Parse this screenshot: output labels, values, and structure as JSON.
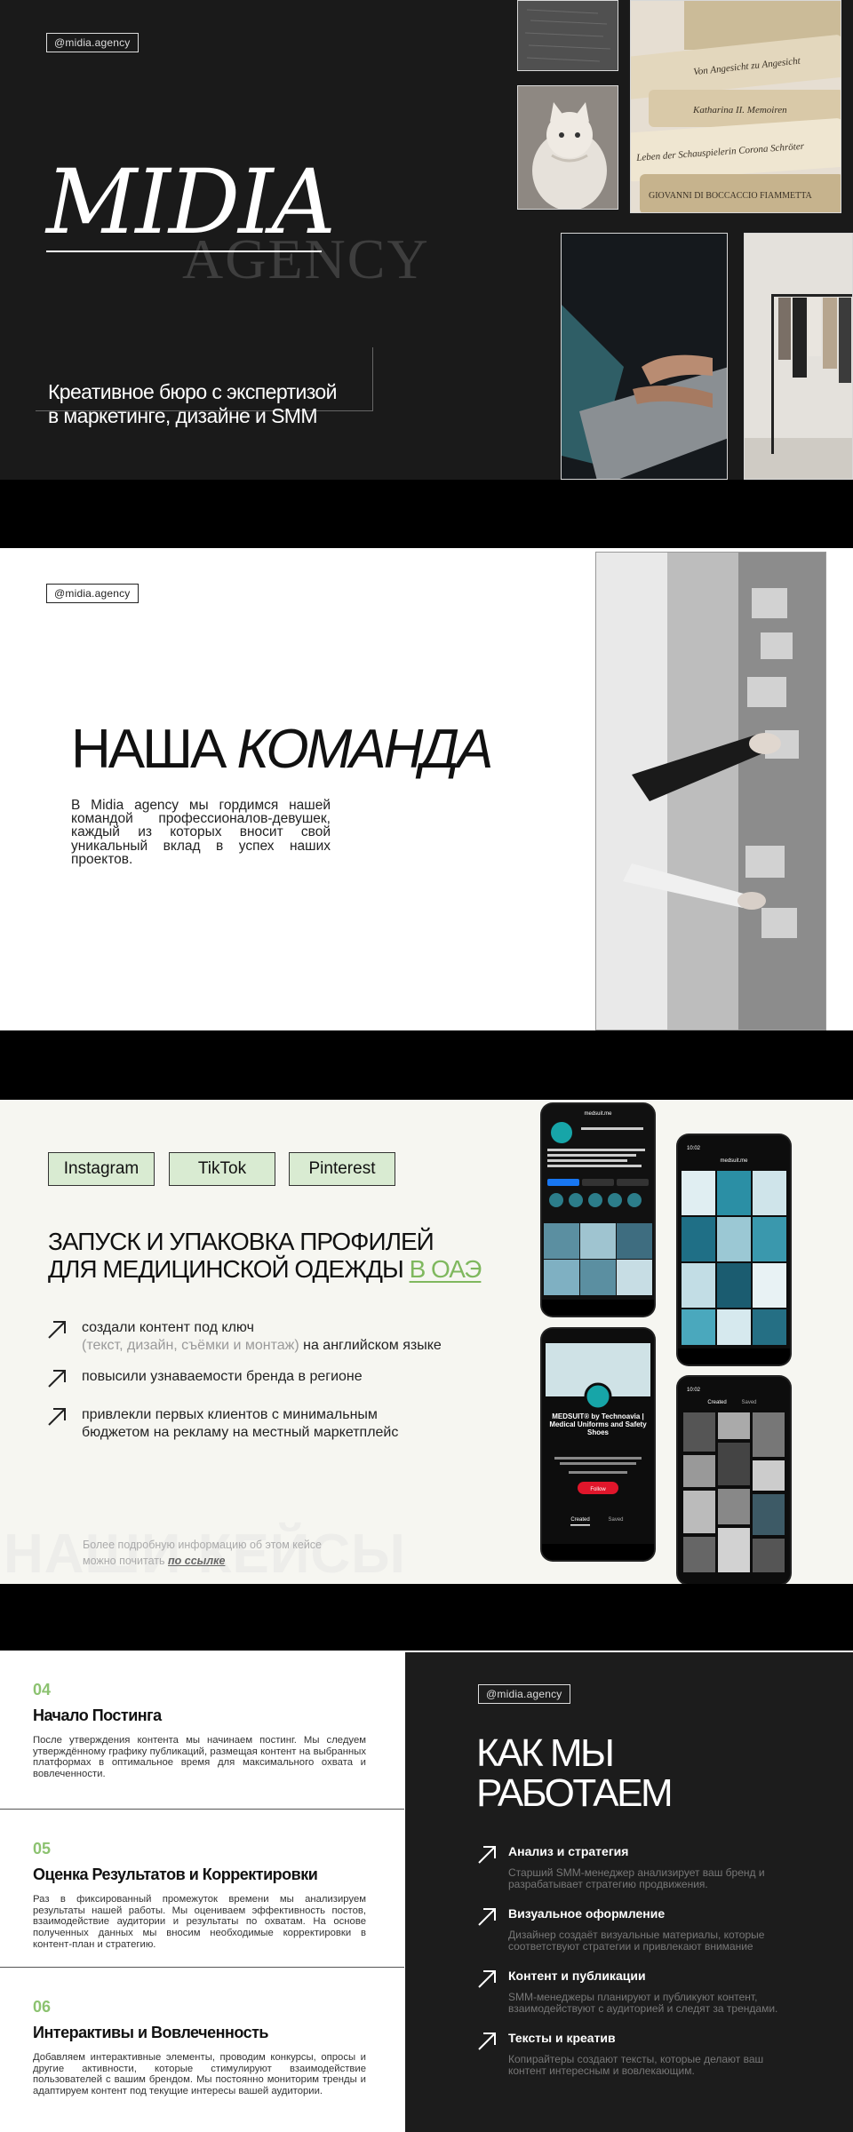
{
  "handle": "@midia.agency",
  "slide1": {
    "brand": "MIDIA",
    "brand_sub": "AGENCY",
    "tagline_l1": "Креативное бюро с экспертизой",
    "tagline_l2": "в маркетинге, дизайне и SMM",
    "book_texts": [
      "Von Angesicht zu Angesicht",
      "Katharina II. Memoiren",
      "Leben der Schauspielerin Corona Schröter",
      "GIOVANNI DI BOCCACCIO FIAMMETTA"
    ]
  },
  "slide2": {
    "title_a": "НАША",
    "title_b": "КОМАНДА",
    "description": "В Midia agency мы гордимся нашей командой профессионалов-девушек, каждый из которых вносит свой уникальный вклад в успех наших проектов."
  },
  "slide3": {
    "tabs": [
      "Instagram",
      "TikTok",
      "Pinterest"
    ],
    "title_l1": "ЗАПУСК И УПАКОВКА ПРОФИЛЕЙ",
    "title_l2": "ДЛЯ МЕДИЦИНСКОЙ ОДЕЖДЫ",
    "title_hl": "В ОАЭ",
    "b1_a": "создали контент под ключ",
    "b1_grey": "(текст, дизайн, съёмки и монтаж)",
    "b1_b": "на английском языке",
    "b2": "повысили узнаваемости бренда в регионе",
    "b3_l1": "привлекли первых клиентов с минимальным",
    "b3_l2": "бюджетом на рекламу на местный маркетплейс",
    "more_l1": "Более подробную информацию об этом кейсе",
    "more_l2": "можно почитать",
    "more_link": "по ссылке",
    "ghost": "НАШИ КЕЙСЫ",
    "phone_account": "medsuit.me",
    "phone_profile_title": "MEDSUIT® by Technoavia | Medical Uniforms and Safety Shoes",
    "phone_follow": "Follow",
    "phone_created": "Created",
    "phone_saved": "Saved",
    "phone_time": "10:02"
  },
  "slide4": {
    "steps": [
      {
        "num": "04",
        "title": "Начало Постинга",
        "text": "После утверждения контента мы начинаем постинг. Мы следуем утверждённому графику публикаций, размещая контент на выбранных платформах в оптимальное время для максимального охвата и вовлеченности."
      },
      {
        "num": "05",
        "title": "Оценка Результатов и Корректировки",
        "text": "Раз в фиксированный промежуток времени мы анализируем результаты нашей работы. Мы оцениваем эффективность постов, взаимодействие аудитории и результаты по охватам. На основе полученных данных мы вносим необходимые корректировки в контент-план и стратегию."
      },
      {
        "num": "06",
        "title": "Интерактивы и Вовлеченность",
        "text": "Добавляем интерактивные элементы, проводим конкурсы, опросы и другие активности, которые стимулируют взаимодействие пользователей с вашим брендом. Мы постоянно мониторим тренды и адаптируем контент под текущие интересы вашей аудитории."
      }
    ],
    "how_l1": "КАК МЫ",
    "how_l2": "РАБОТАЕМ",
    "items": [
      {
        "title": "Анализ и стратегия",
        "text": "Старший SMM-менеджер анализирует ваш бренд и разрабатывает стратегию продвижения."
      },
      {
        "title": "Визуальное оформление",
        "text": "Дизайнер создаёт визуальные материалы, которые соответствуют стратегии и привлекают внимание"
      },
      {
        "title": "Контент и публикации",
        "text": "SMM-менеджеры планируют и публикуют контент, взаимодействуют с аудиторией и следят за трендами."
      },
      {
        "title": "Тексты и креатив",
        "text": "Копирайтеры создают тексты, которые делают ваш контент интересным и вовлекающим."
      }
    ]
  },
  "colors": {
    "accent_green": "#7fb85e",
    "pill_green": "#d9ebd2",
    "dark_bg": "#1c1c1c"
  }
}
